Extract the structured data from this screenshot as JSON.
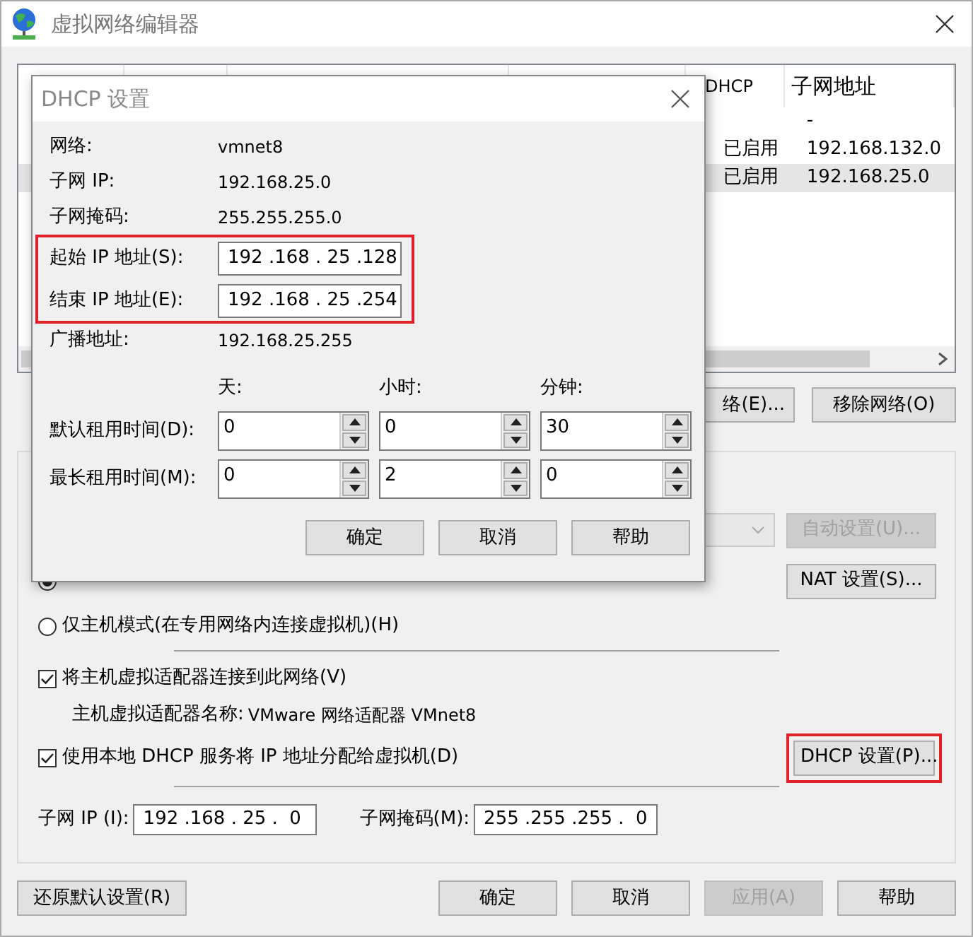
{
  "window": {
    "title": "虚拟网络编辑器"
  },
  "table": {
    "columns": [
      "DHCP",
      "子网地址"
    ],
    "rows": [
      {
        "cells": [
          "",
          "-"
        ],
        "selected": false
      },
      {
        "cells": [
          "已启用",
          "192.168.132.0"
        ],
        "selected": false
      },
      {
        "cells": [
          "已启用",
          "192.168.25.0"
        ],
        "selected": true
      }
    ]
  },
  "network_buttons": [
    {
      "label": "络(E)..."
    },
    {
      "label": "移除网络(O)"
    }
  ],
  "vmnet_info": {
    "dropdown": {
      "disabled": true
    },
    "auto_button": {
      "label": "自动设置(U)...",
      "disabled": true
    },
    "nat_button": {
      "label": "NAT 设置(S)..."
    },
    "modes": [
      {
        "selected": true
      },
      {
        "label": "仅主机模式(在专用网络内连接虚拟机)(H)",
        "selected": false
      }
    ],
    "connect_adapter": {
      "label": "将主机虚拟适配器连接到此网络(V)",
      "checked": true
    },
    "adapter_name": {
      "label": "主机虚拟适配器名称:",
      "value": "VMware 网络适配器 VMnet8"
    },
    "use_dhcp": {
      "label": "使用本地 DHCP 服务将 IP 地址分配给虚拟机(D)",
      "checked": true
    },
    "dhcp_button": {
      "label": "DHCP 设置(P)...",
      "highlighted": true
    },
    "subnet_ip": {
      "label": "子网 IP (I):",
      "value": "192 .168 . 25 .  0"
    },
    "subnet_mask": {
      "label": "子网掩码(M):",
      "value": "255 .255 .255 .  0"
    }
  },
  "footer_buttons": [
    {
      "label": "还原默认设置(R)",
      "disabled": false
    },
    {
      "label": "确定",
      "disabled": false
    },
    {
      "label": "取消",
      "disabled": false
    },
    {
      "label": "应用(A)",
      "disabled": true
    },
    {
      "label": "帮助",
      "disabled": false
    }
  ],
  "dhcp_dialog": {
    "title": "DHCP 设置",
    "info": [
      {
        "label": "网络:",
        "value": "vmnet8"
      },
      {
        "label": "子网 IP:",
        "value": "192.168.25.0"
      },
      {
        "label": "子网掩码:",
        "value": "255.255.255.0"
      }
    ],
    "range": {
      "highlighted": true,
      "fields": [
        {
          "label": "起始 IP 地址(S):",
          "value": "192 .168 . 25 .128"
        },
        {
          "label": "结束 IP 地址(E):",
          "value": "192 .168 . 25 .254"
        }
      ]
    },
    "broadcast": {
      "label": "广播地址:",
      "value": "192.168.25.255"
    },
    "lease_headers": [
      "天:",
      "小时:",
      "分钟:"
    ],
    "leases": [
      {
        "label": "默认租用时间(D):",
        "values": [
          "0",
          "0",
          "30"
        ]
      },
      {
        "label": "最长租用时间(M):",
        "values": [
          "0",
          "2",
          "0"
        ]
      }
    ],
    "buttons": [
      "确定",
      "取消",
      "帮助"
    ]
  }
}
